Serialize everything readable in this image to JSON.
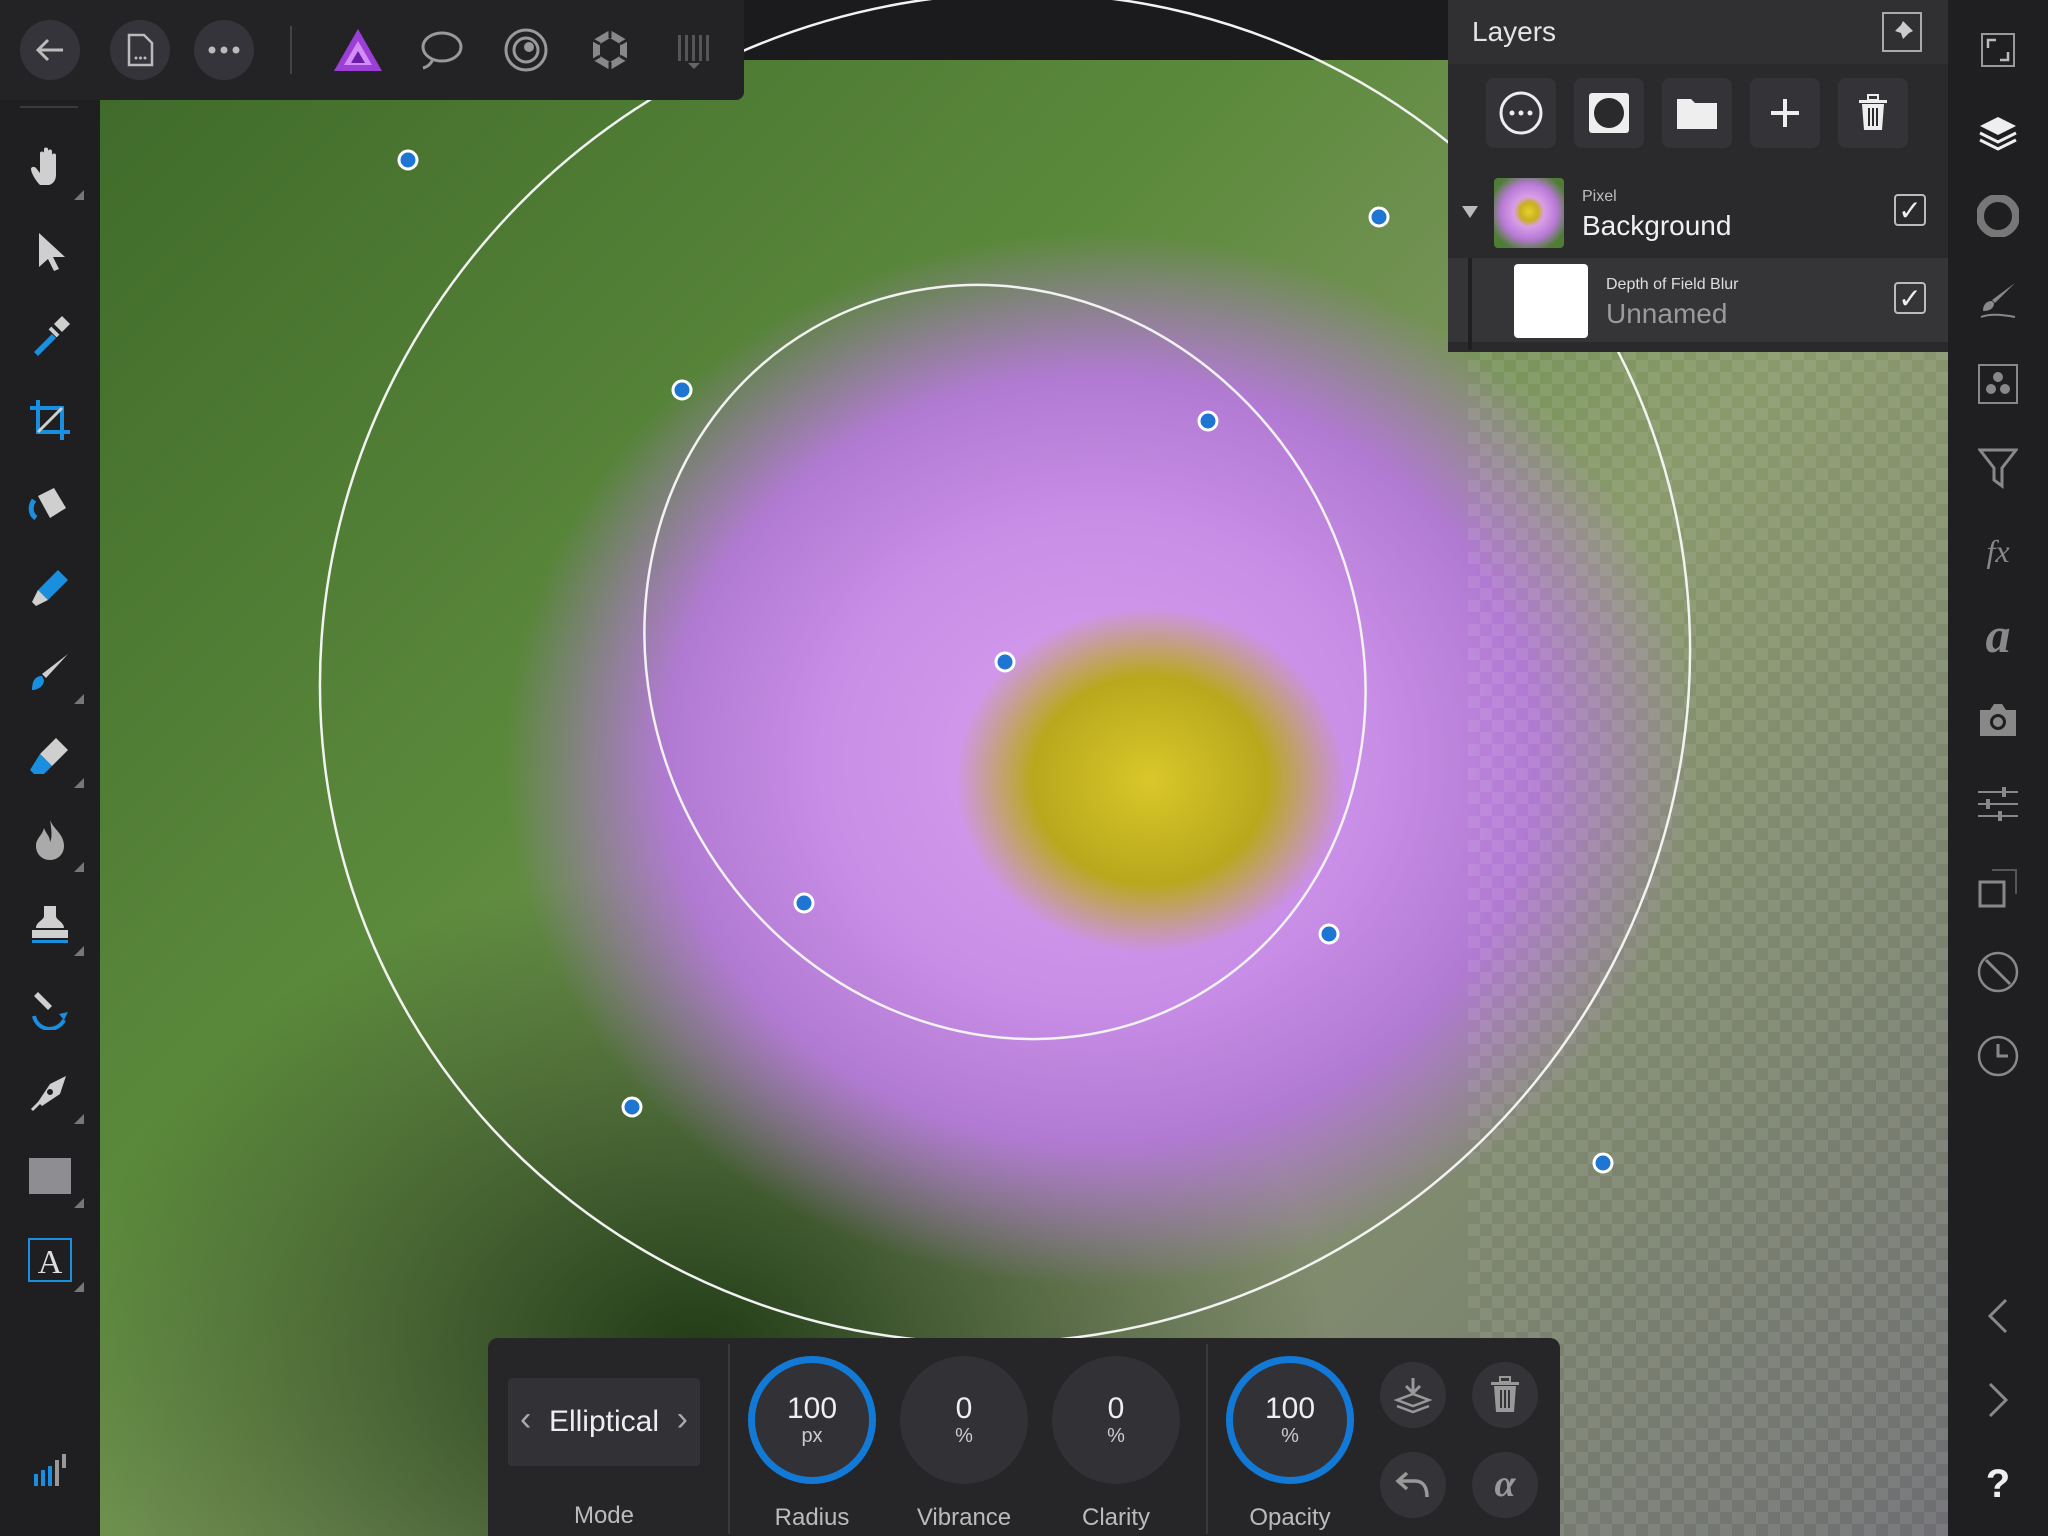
{
  "app": {
    "accent": "#1279d6"
  },
  "topbar": {
    "buttons": [
      "back-icon",
      "document-icon",
      "more-icon"
    ],
    "personas": [
      "photo-persona-icon",
      "liquify-persona-icon",
      "develop-persona-icon",
      "tone-mapping-persona-icon",
      "export-persona-icon"
    ]
  },
  "layers": {
    "title": "Layers",
    "rows": [
      {
        "type": "Pixel",
        "name": "Background",
        "checked": true
      },
      {
        "type": "Depth of Field Blur",
        "name": "Unnamed",
        "checked": true
      }
    ]
  },
  "context": {
    "mode": {
      "value": "Elliptical",
      "label": "Mode"
    },
    "radius": {
      "value": "100",
      "unit": "px",
      "label": "Radius"
    },
    "vibrance": {
      "value": "0",
      "unit": "%",
      "label": "Vibrance"
    },
    "clarity": {
      "value": "0",
      "unit": "%",
      "label": "Clarity"
    },
    "opacity": {
      "value": "100",
      "unit": "%",
      "label": "Opacity"
    }
  },
  "rightbar": {
    "help": "?"
  }
}
